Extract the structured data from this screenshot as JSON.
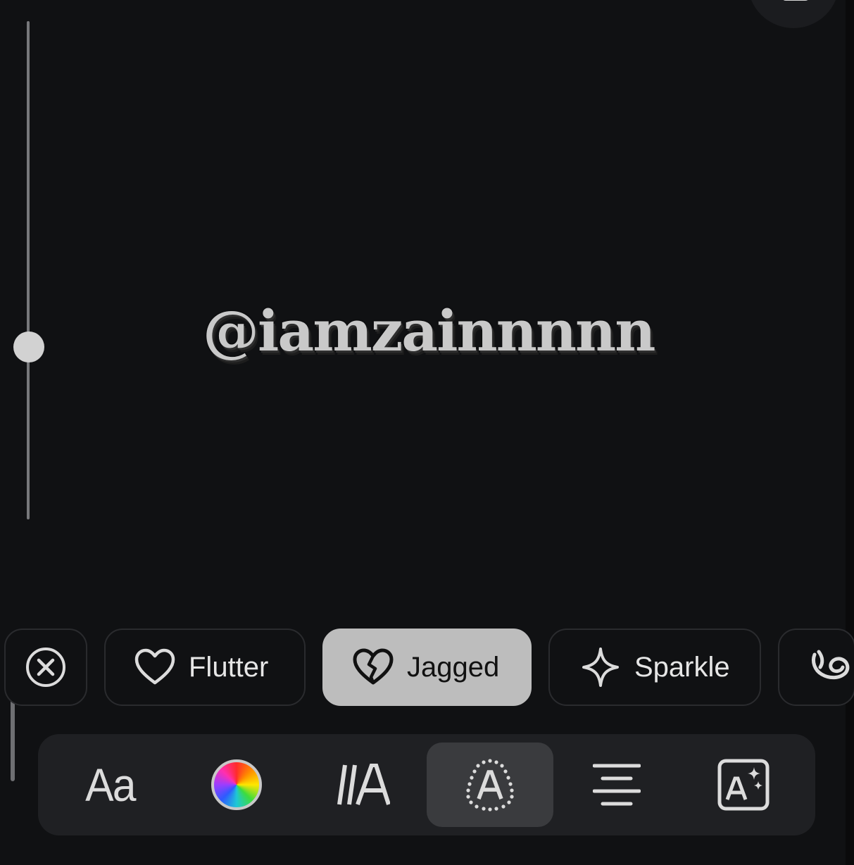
{
  "editor": {
    "preview_text": "@iamzainnnnn"
  },
  "effects": {
    "items": [
      {
        "label": "",
        "icon": "clear-circle-icon"
      },
      {
        "label": "Flutter",
        "icon": "heart-icon"
      },
      {
        "label": "Jagged",
        "icon": "broken-heart-icon",
        "selected": true
      },
      {
        "label": "Sparkle",
        "icon": "sparkle-icon"
      },
      {
        "label": "",
        "icon": "swirl-icon"
      }
    ]
  },
  "toolbar": {
    "font_label": "Aa",
    "tools": [
      "font-icon",
      "color-wheel-icon",
      "font-style-icon",
      "text-effects-icon",
      "align-center-icon",
      "ai-text-icon"
    ],
    "active_tool": "text-effects-icon"
  },
  "colors": {
    "background": "#101113",
    "selected_pill": "#bdbdbd",
    "toolbar": "#1f2023",
    "active_tool": "#3a3b3e"
  }
}
